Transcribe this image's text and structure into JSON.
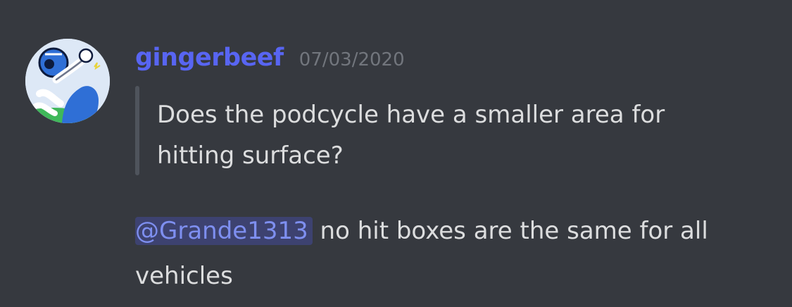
{
  "message": {
    "author": "gingerbeef",
    "timestamp": "07/03/2020",
    "quote": "Does the podcycle have a smaller area for hitting surface?",
    "mention": "@Grande1313",
    "reply_text": " no hit boxes are the same for all vehicles"
  },
  "avatar": {
    "icon": "character-avatar-icon"
  },
  "colors": {
    "background": "#36393f",
    "username": "#5865f2",
    "timestamp": "#72767d",
    "text": "#dcddde",
    "quote_bar": "#4f545c",
    "mention_bg": "#3d4270",
    "mention_text": "#7e8ff0"
  }
}
